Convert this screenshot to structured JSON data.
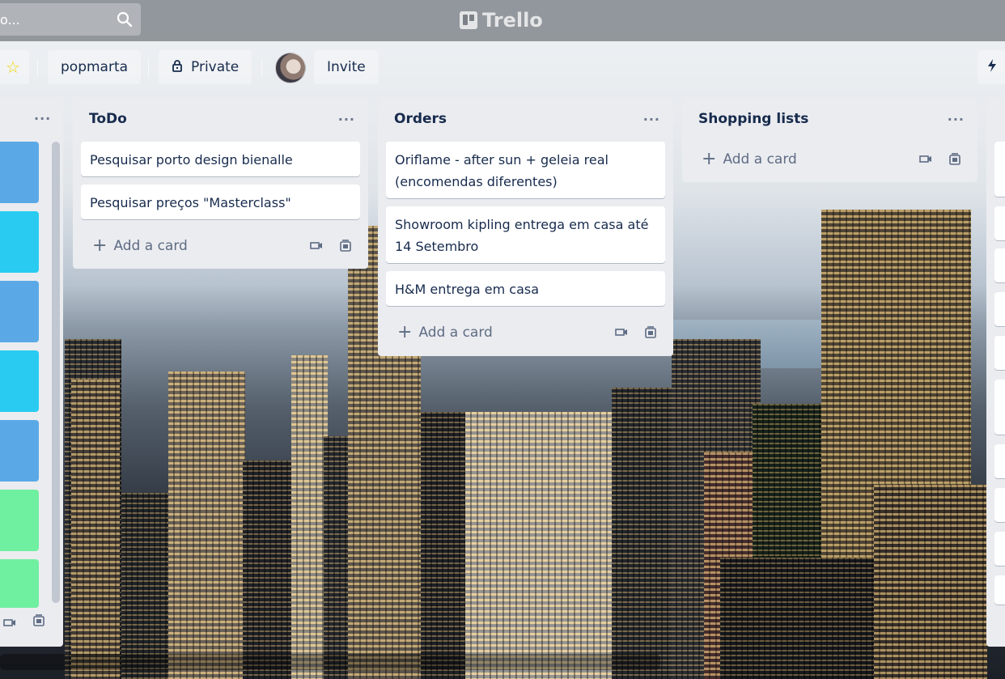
{
  "app": {
    "name": "Trello"
  },
  "search": {
    "placeholder": "o..."
  },
  "board": {
    "workspace": "popmarta",
    "visibility": "Private",
    "invite_label": "Invite"
  },
  "colors": {
    "card_blue": "#5aa9e6",
    "card_cyan": "#29ccf0",
    "card_green": "#6ff0a0",
    "list_bg": "#ebecf0",
    "star": "#f2d600"
  },
  "lists": [
    {
      "title": "",
      "menu": "···",
      "cards": [],
      "label_colors": [
        "blue",
        "cyan",
        "blue",
        "cyan",
        "blue",
        "green",
        "green"
      ]
    },
    {
      "title": "ToDo",
      "menu": "···",
      "cards": [
        "Pesquisar porto design bienalle",
        "Pesquisar preços \"Masterclass\""
      ],
      "add_label": "Add a card"
    },
    {
      "title": "Orders",
      "menu": "···",
      "cards": [
        "Oriflame - after sun + geleia real (encomendas diferentes)",
        "Showroom kipling entrega em casa até 14 Setembro",
        "H&M entrega em casa"
      ],
      "add_label": "Add a card"
    },
    {
      "title": "Shopping lists",
      "menu": "···",
      "cards": [],
      "add_label": "Add a card"
    }
  ],
  "icons": {
    "plus": "+"
  }
}
